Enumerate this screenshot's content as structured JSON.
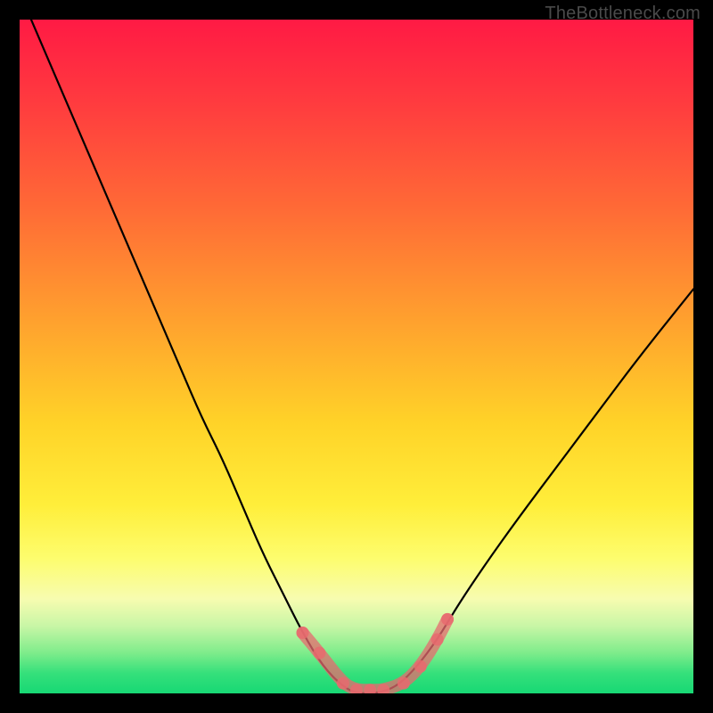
{
  "watermark": "TheBottleneck.com",
  "chart_data": {
    "type": "line",
    "title": "",
    "xlabel": "",
    "ylabel": "",
    "xlim": [
      0,
      100
    ],
    "ylim": [
      0,
      100
    ],
    "series": [
      {
        "name": "bottleneck-curve",
        "x": [
          0,
          3,
          6,
          9,
          12,
          15,
          18,
          21,
          24,
          27,
          30,
          33,
          36,
          39,
          42,
          45,
          48,
          50,
          53,
          56,
          59,
          62,
          65,
          69,
          74,
          80,
          86,
          92,
          100
        ],
        "values": [
          104,
          97,
          90,
          83,
          76,
          69,
          62,
          55,
          48,
          41,
          35,
          28,
          21,
          15,
          9,
          4,
          1,
          0,
          0,
          1,
          4,
          8,
          13,
          19,
          26,
          34,
          42,
          50,
          60
        ]
      }
    ],
    "markers": {
      "name": "highlight-dots",
      "color": "#e76a6f",
      "x": [
        42,
        44.5,
        48,
        50,
        52,
        54,
        57,
        59.5,
        62,
        63.5
      ],
      "values": [
        9,
        6,
        1.5,
        0.5,
        0.5,
        0.5,
        1.5,
        4,
        8,
        11
      ]
    },
    "gradient_stops": [
      {
        "pos": 0,
        "color": "#ff1a44"
      },
      {
        "pos": 28,
        "color": "#ff6a36"
      },
      {
        "pos": 60,
        "color": "#ffd328"
      },
      {
        "pos": 80,
        "color": "#fdfd6e"
      },
      {
        "pos": 94,
        "color": "#7eec8b"
      },
      {
        "pos": 100,
        "color": "#17d874"
      }
    ]
  }
}
